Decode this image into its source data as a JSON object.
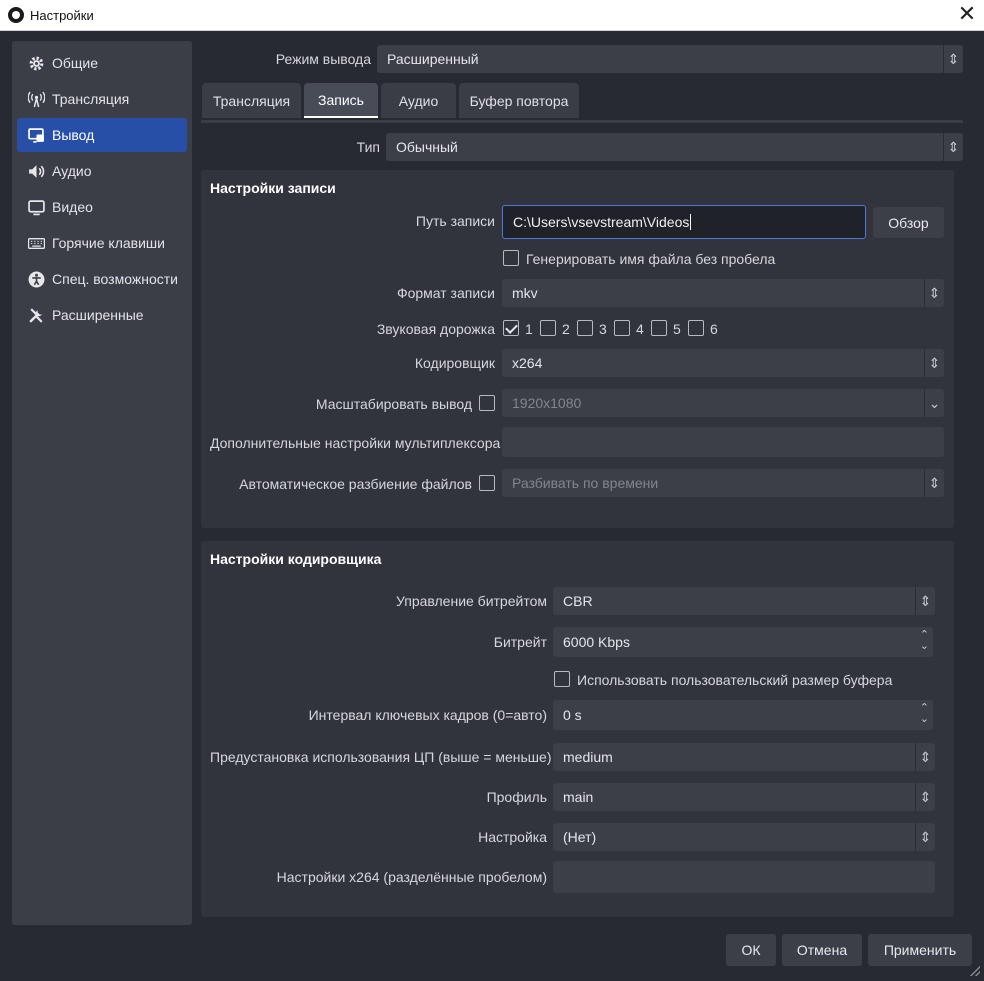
{
  "window": {
    "title": "Настройки",
    "close": "✕"
  },
  "sidebar": {
    "items": [
      {
        "label": "Общие",
        "icon": "gear-icon"
      },
      {
        "label": "Трансляция",
        "icon": "antenna-icon"
      },
      {
        "label": "Вывод",
        "icon": "output-icon",
        "active": true
      },
      {
        "label": "Аудио",
        "icon": "speaker-icon"
      },
      {
        "label": "Видео",
        "icon": "monitor-icon"
      },
      {
        "label": "Горячие клавиши",
        "icon": "keyboard-icon"
      },
      {
        "label": "Спец. возможности",
        "icon": "accessibility-icon"
      },
      {
        "label": "Расширенные",
        "icon": "tools-icon"
      }
    ]
  },
  "output_mode": {
    "label": "Режим вывода",
    "value": "Расширенный"
  },
  "tabs": [
    {
      "label": "Трансляция"
    },
    {
      "label": "Запись",
      "active": true
    },
    {
      "label": "Аудио"
    },
    {
      "label": "Буфер повтора"
    }
  ],
  "type": {
    "label": "Тип",
    "value": "Обычный"
  },
  "recording": {
    "title": "Настройки записи",
    "path_label": "Путь записи",
    "path_value": "C:\\Users\\vsevstream\\Videos",
    "browse": "Обзор",
    "no_space_label": "Генерировать имя файла без пробела",
    "no_space_checked": false,
    "format_label": "Формат записи",
    "format_value": "mkv",
    "tracks_label": "Звуковая дорожка",
    "tracks": [
      {
        "label": "1",
        "checked": true
      },
      {
        "label": "2",
        "checked": false
      },
      {
        "label": "3",
        "checked": false
      },
      {
        "label": "4",
        "checked": false
      },
      {
        "label": "5",
        "checked": false
      },
      {
        "label": "6",
        "checked": false
      }
    ],
    "encoder_label": "Кодировщик",
    "encoder_value": "x264",
    "rescale_label": "Масштабировать вывод",
    "rescale_checked": false,
    "rescale_value": "1920x1080",
    "muxer_label": "Дополнительные настройки мультиплексора",
    "muxer_value": "",
    "split_label": "Автоматическое разбиение файлов",
    "split_checked": false,
    "split_value": "Разбивать по времени"
  },
  "encoder": {
    "title": "Настройки кодировщика",
    "rate_control_label": "Управление битрейтом",
    "rate_control_value": "CBR",
    "bitrate_label": "Битрейт",
    "bitrate_value": "6000 Kbps",
    "custom_buffer_label": "Использовать пользовательский размер буфера",
    "custom_buffer_checked": false,
    "keyframe_label": "Интервал ключевых кадров (0=авто)",
    "keyframe_value": "0 s",
    "preset_label": "Предустановка использования ЦП (выше = меньше)",
    "preset_value": "medium",
    "profile_label": "Профиль",
    "profile_value": "main",
    "tune_label": "Настройка",
    "tune_value": "(Нет)",
    "x264opts_label": "Настройки x264 (разделённые пробелом)",
    "x264opts_value": ""
  },
  "buttons": {
    "ok": "ОК",
    "cancel": "Отмена",
    "apply": "Применить"
  }
}
